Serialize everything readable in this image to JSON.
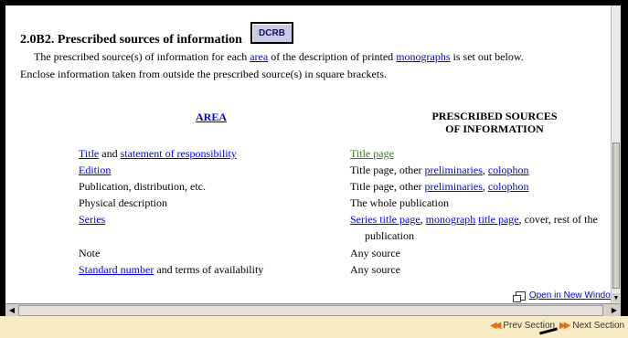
{
  "section": {
    "heading": "2.0B2. Prescribed sources of information",
    "dcrb_label": "DCRB",
    "intro": {
      "t1": "The prescribed source(s) of information for each ",
      "l1": "area",
      "t2": " of the description of printed ",
      "l2": "monographs",
      "t3": " is set out below.",
      "t4": "Enclose information taken from outside the prescribed source(s) in square brackets."
    }
  },
  "table": {
    "area_header": "AREA",
    "source_header_line1": "PRESCRIBED SOURCES",
    "source_header_line2": "OF INFORMATION",
    "rows": {
      "r1": {
        "area_link1": "Title",
        "area_mid": " and ",
        "area_link2": "statement of responsibility",
        "source_link": "Title page"
      },
      "r2": {
        "area_link": "Edition",
        "source_text": "Title page, other ",
        "source_link1": "preliminaries",
        "source_sep": ", ",
        "source_link2": "colophon"
      },
      "r3": {
        "area_text": "Publication, distribution, etc.",
        "source_text": "Title page, other ",
        "source_link1": "preliminaries",
        "source_sep": ", ",
        "source_link2": "colophon"
      },
      "r4": {
        "area_text": "Physical description",
        "source_text": "The whole publication"
      },
      "r5": {
        "area_link": "Series",
        "source_link1": "Series title page",
        "source_sep1": ", ",
        "source_link2": "monograph",
        "source_sp": " ",
        "source_link3": "title page",
        "source_text": ", cover, rest of the",
        "source_cont": "publication"
      },
      "r6": {
        "area_text": "Note",
        "source_text": "Any source"
      },
      "r7": {
        "area_link": "Standard number",
        "area_text": " and terms of availability",
        "source_text": "Any source"
      }
    }
  },
  "links": {
    "open_new_window": "Open in New Window"
  },
  "footer": {
    "prev_section": "Prev Section",
    "next_section": "Next Section"
  }
}
